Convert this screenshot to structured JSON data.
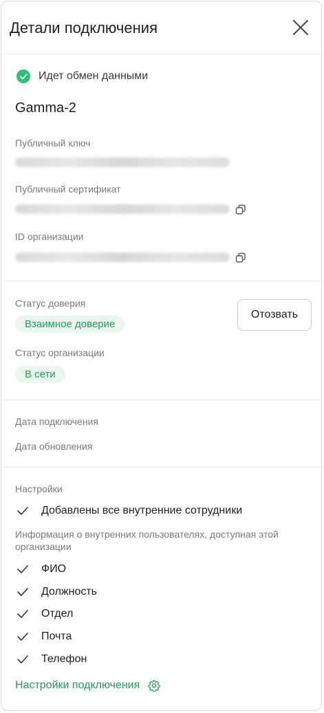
{
  "header": {
    "title": "Детали подключения"
  },
  "connection": {
    "status_text": "Идет обмен данными",
    "status_color": "#2fbf71",
    "org_name": "Gamma-2",
    "public_key_label": "Публичный ключ",
    "public_certificate_label": "Публичный сертификат",
    "org_id_label": "ID организации"
  },
  "trust": {
    "trust_status_label": "Статус доверия",
    "trust_status_value": "Взаимное доверие",
    "revoke_label": "Отозвать",
    "org_status_label": "Статус организации",
    "org_status_value": "В сети"
  },
  "dates": {
    "connected_label": "Дата подключения",
    "updated_label": "Дата обновления"
  },
  "settings": {
    "section_label": "Настройки",
    "all_employees_added": "Добавлены все внутренние сотрудники",
    "info_label": "Информация о внутренних пользователях, доступная этой организации",
    "fields": [
      "ФИО",
      "Должность",
      "Отдел",
      "Почта",
      "Телефон"
    ],
    "link_label": "Настройки подключения"
  },
  "colors": {
    "accent": "#1f9d5b",
    "badge_bg": "#e8f6ee"
  }
}
